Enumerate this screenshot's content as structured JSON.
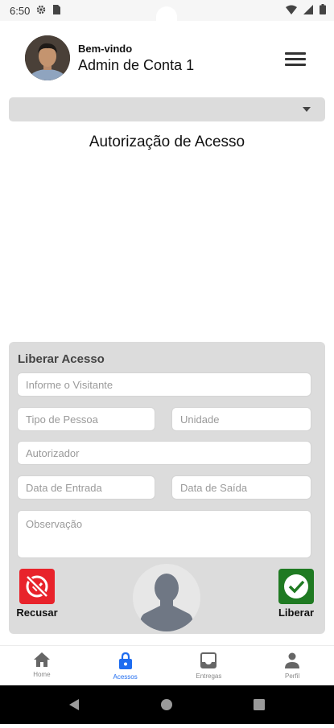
{
  "status_bar": {
    "time": "6:50",
    "icons_left": [
      "gear-icon",
      "sim-card-icon"
    ],
    "icons_right": [
      "wifi-icon",
      "signal-icon",
      "battery-icon"
    ]
  },
  "header": {
    "welcome": "Bem-vindo",
    "user_name": "Admin de Conta 1",
    "menu_icon": "hamburger-menu-icon"
  },
  "selector": {
    "selected_value": ""
  },
  "page": {
    "title": "Autorização de Acesso"
  },
  "form": {
    "title": "Liberar Acesso",
    "visitor": {
      "placeholder": "Informe o Visitante",
      "value": ""
    },
    "person_type": {
      "placeholder": "Tipo de Pessoa",
      "value": ""
    },
    "unit": {
      "placeholder": "Unidade",
      "value": ""
    },
    "authorizer": {
      "placeholder": "Autorizador",
      "value": ""
    },
    "entry_date": {
      "placeholder": "Data de Entrada",
      "value": ""
    },
    "exit_date": {
      "placeholder": "Data de Saída",
      "value": ""
    },
    "notes": {
      "placeholder": "Observação",
      "value": ""
    },
    "reject_label": "Recusar",
    "approve_label": "Liberar"
  },
  "colors": {
    "reject": "#e8232b",
    "approve": "#1f7a22",
    "active_nav": "#1e6cf0",
    "card_bg": "#dcdcdc"
  },
  "bottom_nav": {
    "items": [
      {
        "label": "Home",
        "icon": "home-icon",
        "active": false
      },
      {
        "label": "Acessos",
        "icon": "lock-icon",
        "active": true
      },
      {
        "label": "Entregas",
        "icon": "inbox-icon",
        "active": false
      },
      {
        "label": "Perfil",
        "icon": "person-icon",
        "active": false
      }
    ]
  }
}
